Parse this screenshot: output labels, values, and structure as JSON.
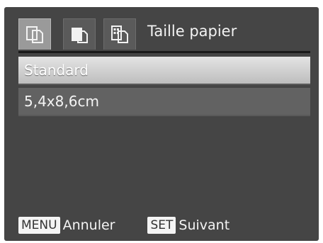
{
  "header": {
    "title": "Taille papier",
    "tabs": [
      {
        "icon": "print-page-icon",
        "active": true
      },
      {
        "icon": "print-page-filled-icon",
        "active": false
      },
      {
        "icon": "print-layout-grid-icon",
        "active": false
      }
    ]
  },
  "list": {
    "items": [
      {
        "label": "Standard",
        "selected": true
      },
      {
        "label": "5,4x8,6cm",
        "selected": false
      }
    ]
  },
  "footer": {
    "menu_key": "MENU",
    "menu_label": "Annuler",
    "set_key": "SET",
    "set_label": "Suivant"
  }
}
